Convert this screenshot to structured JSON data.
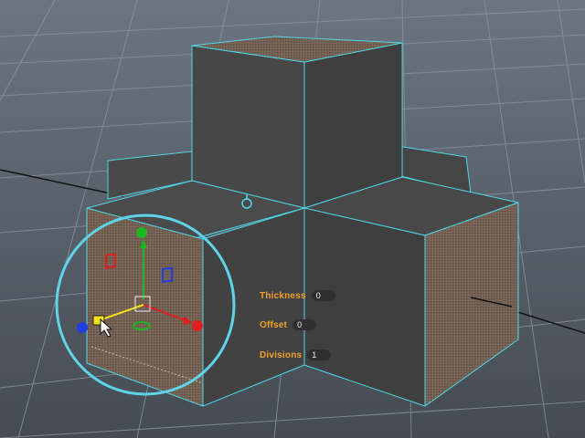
{
  "hud": {
    "thickness": {
      "label": "Thickness",
      "value": "0"
    },
    "offset": {
      "label": "Offset",
      "value": "0"
    },
    "divisions": {
      "label": "Divisions",
      "value": "1"
    }
  },
  "colors": {
    "background_top": "#6b7581",
    "background_bottom": "#454b52",
    "grid_line": "#8d969f",
    "axis_line": "#111111",
    "face_dark": "#464646",
    "face_side": "#3b3b3b",
    "face_top": "#4a4a4a",
    "face_selected": "#7a6658",
    "edge_highlight": "#4fd6e6",
    "gizmo_circle": "#5fd4e8",
    "gizmo_x": "#e01f1f",
    "gizmo_y": "#1fb51f",
    "gizmo_z": "#1f3fe0",
    "gizmo_yellow": "#f2e21a",
    "hud_label": "#f0a12a",
    "hud_field": "#2f2f2f"
  },
  "icons": [
    "pivot-icon",
    "mouse-cursor-icon",
    "move-gizmo-icon"
  ]
}
